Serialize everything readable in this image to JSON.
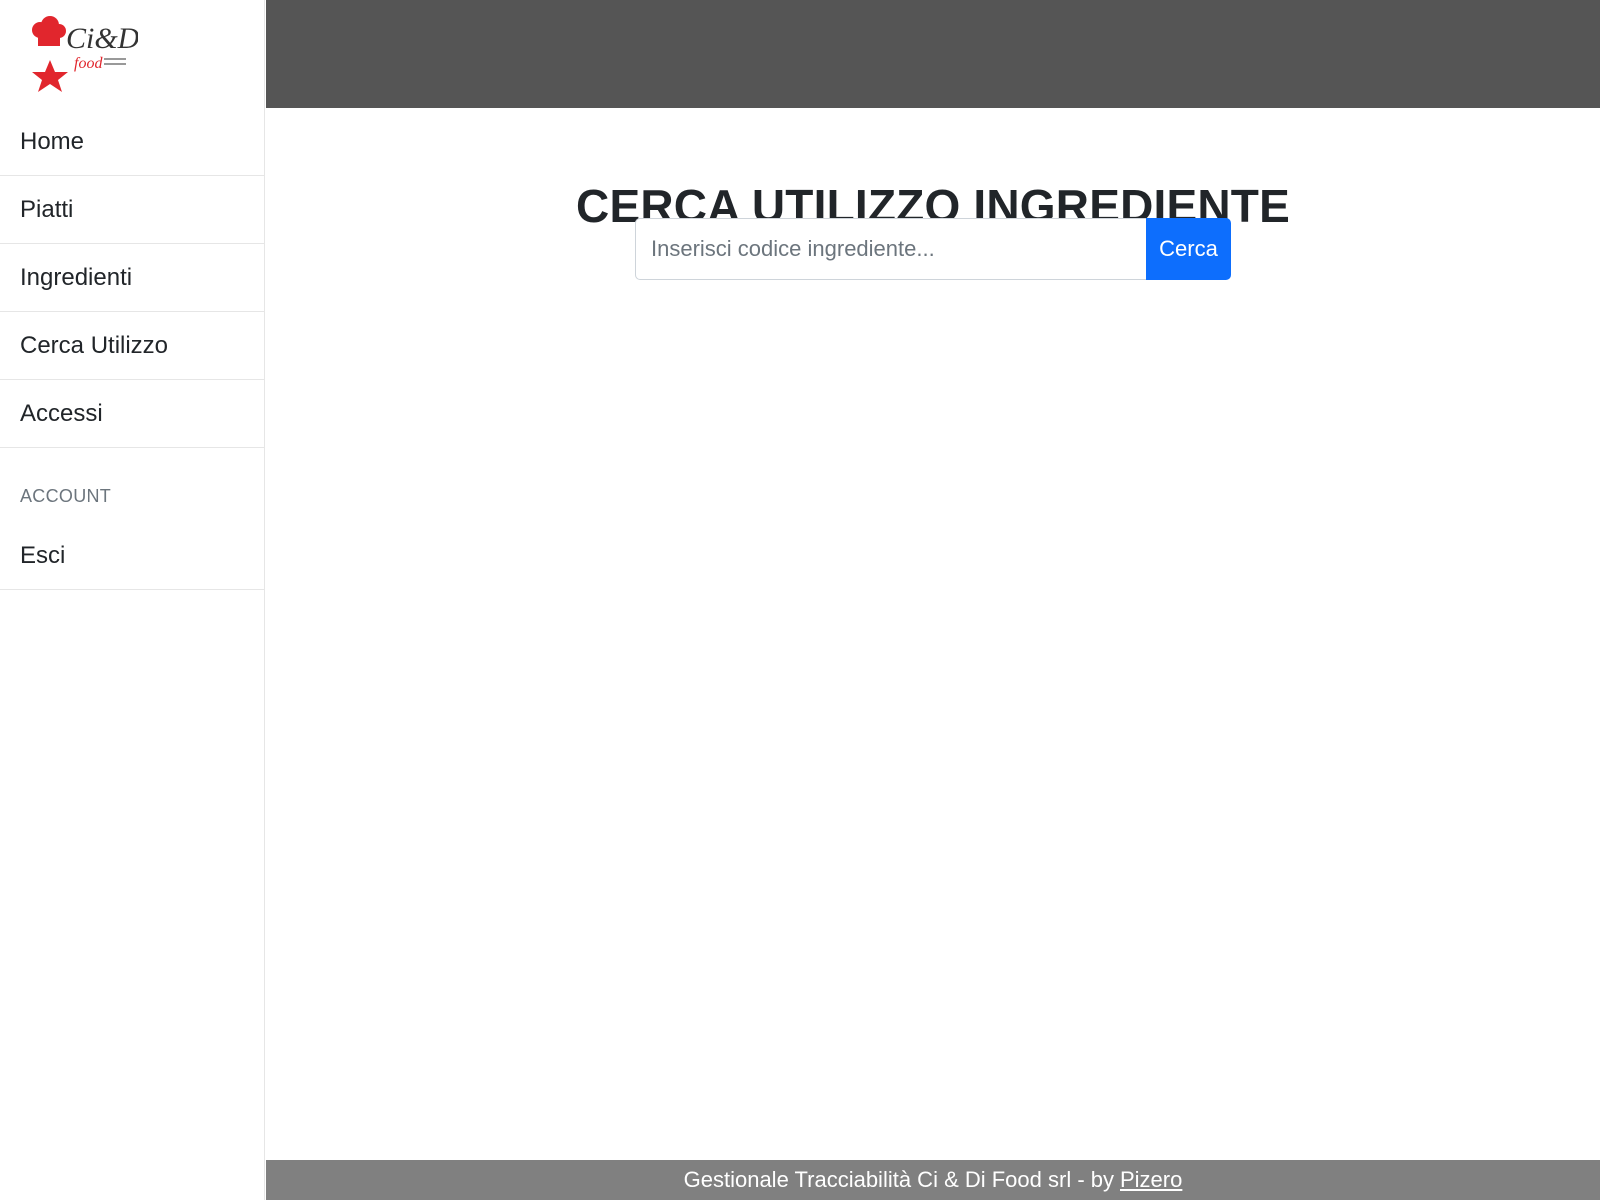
{
  "brand": {
    "logo_text": "Ci&Di",
    "logo_subtext": "food",
    "logo_icon": "chef-star-logo"
  },
  "sidebar": {
    "items": [
      {
        "label": "Home"
      },
      {
        "label": "Piatti"
      },
      {
        "label": "Ingredienti"
      },
      {
        "label": "Cerca Utilizzo"
      },
      {
        "label": "Accessi"
      }
    ],
    "account_heading": "ACCOUNT",
    "account_items": [
      {
        "label": "Esci"
      }
    ]
  },
  "main": {
    "title": "CERCA UTILIZZO INGREDIENTE",
    "search": {
      "placeholder": "Inserisci codice ingrediente...",
      "value": "",
      "button_label": "Cerca"
    }
  },
  "footer": {
    "text": "Gestionale Tracciabilità Ci & Di Food srl - by",
    "link_label": "Pizero"
  },
  "colors": {
    "topbar": "#555555",
    "footer": "#808080",
    "primary": "#0d6efd",
    "logo_red": "#e1262d"
  }
}
